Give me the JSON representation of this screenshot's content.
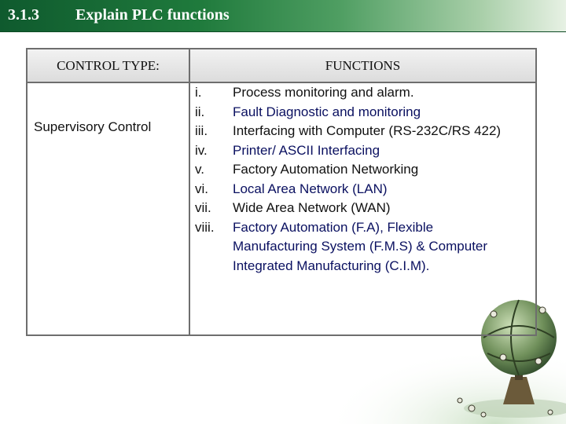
{
  "header": {
    "section_number": "3.1.3",
    "title": "Explain PLC functions",
    "bar_color": "#1f7a3c"
  },
  "table": {
    "col_type_header": "CONTROL TYPE:",
    "col_functions_header": "FUNCTIONS",
    "control_type": "Supervisory Control",
    "functions": [
      {
        "num": "i.",
        "text": "Process monitoring and alarm."
      },
      {
        "num": "ii.",
        "text": "Fault Diagnostic and monitoring"
      },
      {
        "num": "iii.",
        "text": "Interfacing with Computer (RS-232C/RS 422)"
      },
      {
        "num": "iv.",
        "text": "Printer/ ASCII Interfacing"
      },
      {
        "num": "v.",
        "text": "Factory Automation Networking"
      },
      {
        "num": "vi.",
        "text": "Local Area Network (LAN)"
      },
      {
        "num": "vii.",
        "text": "Wide Area Network (WAN)"
      },
      {
        "num": "viii.",
        "text": "Factory Automation (F.A), Flexible Manufacturing System (F.M.S) & Computer Integrated Manufacturing (C.I.M)."
      }
    ]
  },
  "decoration": {
    "icon": "globe-chess-icon"
  }
}
